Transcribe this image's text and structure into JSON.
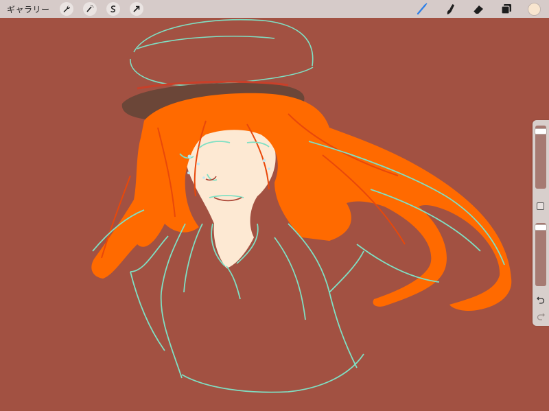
{
  "topbar": {
    "gallery_label": "ギャラリー",
    "left_tools": [
      {
        "name": "actions",
        "icon": "wrench-icon"
      },
      {
        "name": "adjustments",
        "icon": "magic-wand-icon"
      },
      {
        "name": "selection",
        "icon": "selection-s-icon"
      },
      {
        "name": "transform",
        "icon": "arrow-cursor-icon"
      }
    ],
    "right_tools": [
      {
        "name": "brush",
        "icon": "brush-icon",
        "active": true,
        "color": "#2f80e8"
      },
      {
        "name": "smudge",
        "icon": "smudge-icon",
        "active": false
      },
      {
        "name": "eraser",
        "icon": "eraser-icon",
        "active": false
      },
      {
        "name": "layers",
        "icon": "layers-icon",
        "active": false
      }
    ],
    "current_color": "#f8e5cf"
  },
  "canvas": {
    "background_color": "#a25142",
    "hair_color": "#ff6a00",
    "line_color": "#7fe0c4",
    "skin_color": "#fde9d3",
    "hat_brim_color": "#6b4638"
  },
  "sidebar": {
    "brush_size_level": 0.05,
    "opacity_level": 0.02,
    "undo_icon": "undo-icon",
    "redo_icon": "redo-icon"
  }
}
